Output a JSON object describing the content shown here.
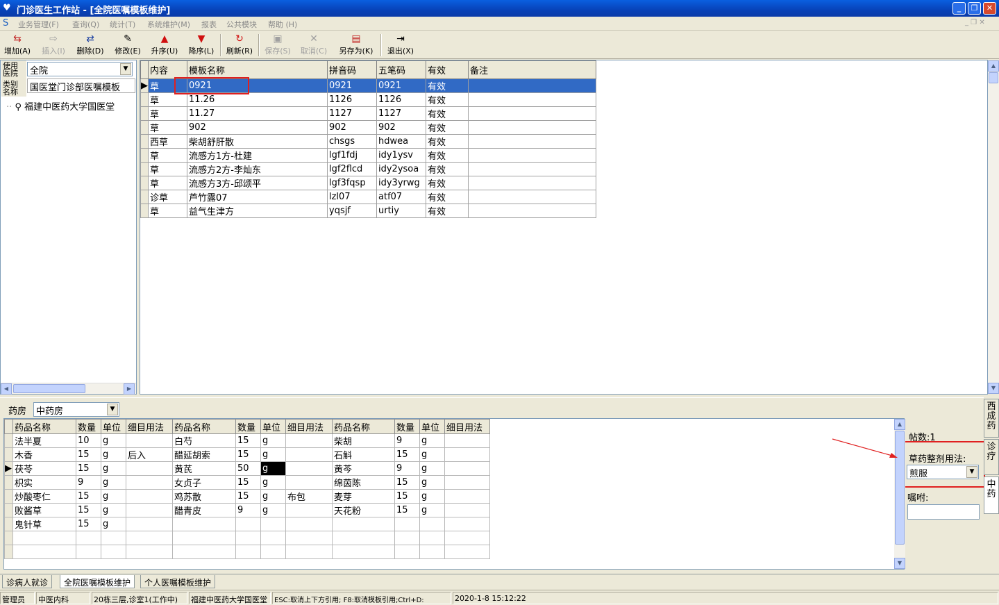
{
  "window": {
    "title": "门诊医生工作站 - [全院医嘱模板维护]"
  },
  "menu": [
    "业务管理(F)",
    "查询(Q)",
    "统计(T)",
    "系统维护(M)",
    "报表",
    "公共模块",
    "帮助 (H)"
  ],
  "toolbar": {
    "add": "增加(A)",
    "insert": "插入(I)",
    "delete": "删除(D)",
    "edit": "修改(E)",
    "asc": "升序(U)",
    "desc": "降序(L)",
    "refresh": "刷新(R)",
    "save": "保存(S)",
    "cancel": "取消(C)",
    "saveas": "另存为(K)",
    "exit": "退出(X)"
  },
  "left": {
    "scope_label": "使用医院",
    "scope_value": "全院",
    "type_label": "类别名称",
    "type_value": "国医堂门诊部医嘱模板",
    "tree_item": "福建中医药大学国医堂"
  },
  "templates": {
    "columns": [
      "内容",
      "模板名称",
      "拼音码",
      "五笔码",
      "有效",
      "备注"
    ],
    "rows": [
      [
        "草",
        "0921",
        "0921",
        "0921",
        "有效",
        ""
      ],
      [
        "草",
        "11.26",
        "1126",
        "1126",
        "有效",
        ""
      ],
      [
        "草",
        "11.27",
        "1127",
        "1127",
        "有效",
        ""
      ],
      [
        "草",
        "902",
        "902",
        "902",
        "有效",
        ""
      ],
      [
        "西草",
        "柴胡舒肝散",
        "chsgs",
        "hdwea",
        "有效",
        ""
      ],
      [
        "草",
        "流感方1方-杜建",
        "lgf1fdj",
        "idy1ysv",
        "有效",
        ""
      ],
      [
        "草",
        "流感方2方-李灿东",
        "lgf2flcd",
        "idy2ysoa",
        "有效",
        ""
      ],
      [
        "草",
        "流感方3方-邱颂平",
        "lgf3fqsp",
        "idy3yrwg",
        "有效",
        ""
      ],
      [
        "诊草",
        "芦竹露07",
        "lzl07",
        "atf07",
        "有效",
        ""
      ],
      [
        "草",
        "益气生津方",
        "yqsjf",
        "urtiy",
        "有效",
        ""
      ]
    ]
  },
  "pharmacy": {
    "label": "药房",
    "value": "中药房"
  },
  "herbs": {
    "columns": [
      "药品名称",
      "数量",
      "单位",
      "细目用法",
      "药品名称",
      "数量",
      "单位",
      "细目用法",
      "药品名称",
      "数量",
      "单位",
      "细目用法"
    ],
    "rows": [
      [
        "法半夏",
        "10",
        "g",
        "",
        "白芍",
        "15",
        "g",
        "",
        "柴胡",
        "9",
        "g",
        ""
      ],
      [
        "木香",
        "15",
        "g",
        "后入",
        "醋延胡索",
        "15",
        "g",
        "",
        "石斛",
        "15",
        "g",
        ""
      ],
      [
        "茯苓",
        "15",
        "g",
        "",
        "黄芪",
        "50",
        "g",
        "",
        "黄芩",
        "9",
        "g",
        ""
      ],
      [
        "枳实",
        "9",
        "g",
        "",
        "女贞子",
        "15",
        "g",
        "",
        "绵茵陈",
        "15",
        "g",
        ""
      ],
      [
        "炒酸枣仁",
        "15",
        "g",
        "",
        "鸡苏散",
        "15",
        "g",
        "布包",
        "麦芽",
        "15",
        "g",
        ""
      ],
      [
        "败酱草",
        "15",
        "g",
        "",
        "醋青皮",
        "9",
        "g",
        "",
        "天花粉",
        "15",
        "g",
        ""
      ],
      [
        "鬼针草",
        "15",
        "g",
        "",
        "",
        "",
        "",
        "",
        "",
        "",
        "",
        ""
      ]
    ]
  },
  "right": {
    "doses": "帖数:1",
    "method_label": "草药整剂用法:",
    "method_value": "煎服",
    "note_label": "嘱咐:"
  },
  "side_tabs": [
    "西成药",
    "诊疗",
    "中药"
  ],
  "bottom_tabs": [
    "诊病人就诊",
    "全院医嘱模板维护",
    "个人医嘱模板维护"
  ],
  "status": [
    "管理员",
    "中医内科",
    "20栋三层,诊室1(工作中)",
    "福建中医药大学国医堂",
    "ESC:取消上下方引用; F8:取消模板引用;Ctrl+D:",
    "2020-1-8 15:12:22"
  ],
  "colors": {
    "title": "#0842b8",
    "selection": "#316ac5",
    "highlight": "#e02020"
  }
}
